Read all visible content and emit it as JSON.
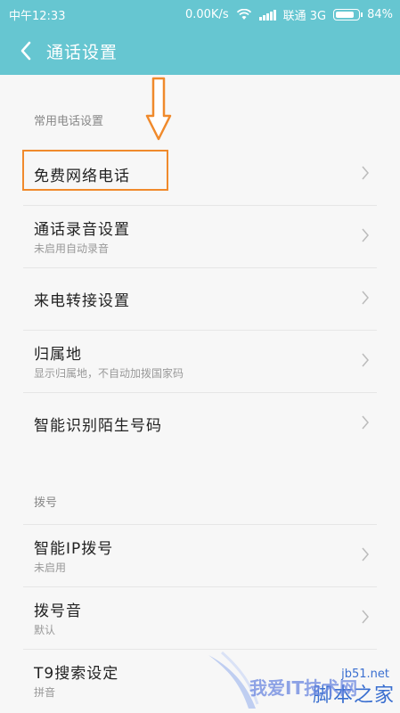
{
  "status_bar": {
    "time": "中午12:33",
    "net_speed": "0.00K/s",
    "carrier": "联通 3G",
    "battery": "84%",
    "battery_level": 0.84
  },
  "header": {
    "title": "通话设置"
  },
  "sections": [
    {
      "label": "常用电话设置",
      "items": [
        {
          "title": "免费网络电话",
          "subtitle": ""
        },
        {
          "title": "通话录音设置",
          "subtitle": "未启用自动录音"
        },
        {
          "title": "来电转接设置",
          "subtitle": ""
        },
        {
          "title": "归属地",
          "subtitle": "显示归属地，不自动加拨国家码"
        },
        {
          "title": "智能识别陌生号码",
          "subtitle": ""
        }
      ]
    },
    {
      "label": "拨号",
      "items": [
        {
          "title": "智能IP拨号",
          "subtitle": "未启用"
        },
        {
          "title": "拨号音",
          "subtitle": "默认"
        },
        {
          "title": "T9搜索设定",
          "subtitle": "拼音"
        }
      ]
    }
  ],
  "watermark": {
    "site": "jb51.net",
    "brand": "脚本之家",
    "slogan": "我爱IT技术网"
  },
  "colors": {
    "header": "#66c6d1",
    "annotation": "#f08a2c"
  }
}
